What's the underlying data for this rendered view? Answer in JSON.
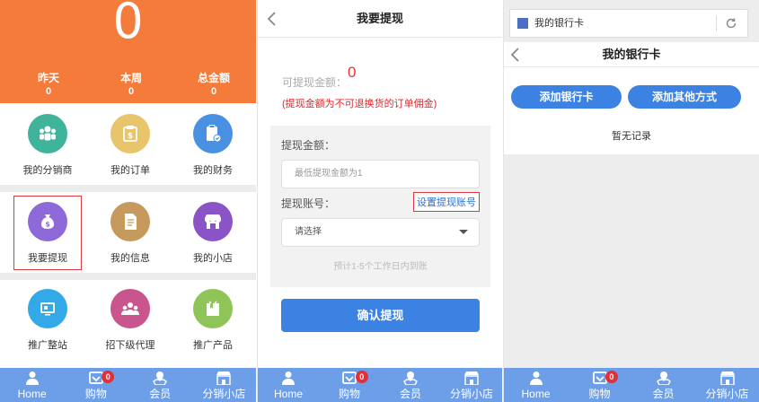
{
  "panel1": {
    "total_big": "0",
    "stats": [
      {
        "label": "昨天",
        "value": "0"
      },
      {
        "label": "本周",
        "value": "0"
      },
      {
        "label": "总金额",
        "value": "0"
      }
    ],
    "row1": [
      {
        "label": "我的分销商",
        "icon": "people-icon",
        "color": "#3fb49a"
      },
      {
        "label": "我的订单",
        "icon": "order-icon",
        "color": "#e8c46a"
      },
      {
        "label": "我的财务",
        "icon": "clipboard-check-icon",
        "color": "#4a90e2"
      }
    ],
    "row2": [
      {
        "label": "我要提现",
        "icon": "money-bag-icon",
        "color": "#8e6ad8"
      },
      {
        "label": "我的信息",
        "icon": "document-icon",
        "color": "#c6995c"
      },
      {
        "label": "我的小店",
        "icon": "shop-icon",
        "color": "#8a54c8"
      }
    ],
    "row3": [
      {
        "label": "推广整站",
        "icon": "screen-icon",
        "color": "#33a9e8"
      },
      {
        "label": "招下级代理",
        "icon": "team-icon",
        "color": "#c8558d"
      },
      {
        "label": "推广产品",
        "icon": "gift-icon",
        "color": "#8fc458"
      }
    ]
  },
  "panel2": {
    "title": "我要提现",
    "available_label": "可提现金额：",
    "available_value": "0",
    "note": "(提现金额为不可退换货的订单佣金)",
    "amount_label": "提现金额：",
    "amount_placeholder": "最低提现金额为1",
    "account_label": "提现账号：",
    "set_account_link": "设置提现账号",
    "select_value": "请选择",
    "hint": "预计1-5个工作日内到账",
    "confirm_button": "确认提现"
  },
  "panel3": {
    "address_text": "我的银行卡",
    "title": "我的银行卡",
    "add_card_button": "添加银行卡",
    "add_other_button": "添加其他方式",
    "empty_text": "暂无记录"
  },
  "nav": [
    {
      "label": "Home",
      "icon": "home-icon"
    },
    {
      "label": "购物",
      "icon": "cart-icon",
      "badge": "0"
    },
    {
      "label": "会员",
      "icon": "member-icon"
    },
    {
      "label": "分销小店",
      "icon": "store-icon"
    }
  ],
  "colors": {
    "header_orange": "#f47b3a",
    "nav_blue": "#6d9ee8",
    "primary_blue": "#3b82e3",
    "alert_red": "#e0262c"
  }
}
